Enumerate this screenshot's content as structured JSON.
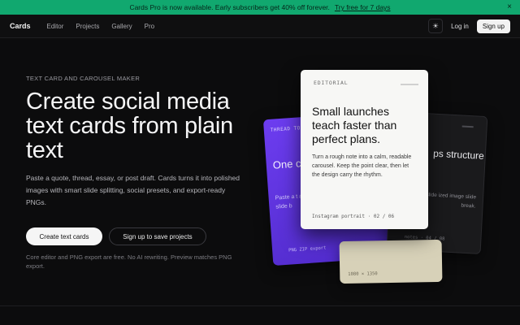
{
  "banner": {
    "message": "Cards Pro is now available. Early subscribers get 40% off forever.",
    "cta": "Try free for 7 days",
    "close": "×"
  },
  "nav": {
    "brand": "Cards",
    "links": [
      "Editor",
      "Projects",
      "Gallery",
      "Pro"
    ],
    "theme_icon": "☀",
    "login": "Log in",
    "signup": "Sign up"
  },
  "hero": {
    "eyebrow": "TEXT CARD AND CAROUSEL MAKER",
    "title": "Create social media text cards from plain text",
    "subtitle": "Paste a quote, thread, essay, or post draft. Cards turns it into polished images with smart slide splitting, social presets, and export-ready PNGs.",
    "primary_cta": "Create text cards",
    "secondary_cta": "Sign up to save projects",
    "note": "Core editor and PNG export are free. No AI rewriting. Preview matches PNG export."
  },
  "cards": {
    "purple": {
      "label": "THREAD TO",
      "headline": "One c clear",
      "body": "Paste a t automat slide b",
      "footer": "PNG ZIP export"
    },
    "dark": {
      "headline": "ps structure",
      "body": "date, or slide ized image slide break.",
      "footer": "notes · 04 / 08"
    },
    "beige": {
      "footer": "1080 × 1350"
    },
    "white": {
      "label": "EDITORIAL",
      "headline": "Small launches teach faster than perfect plans.",
      "body": "Turn a rough note into a calm, readable carousel. Keep the point clear, then let the design carry the rhythm.",
      "footer": "Instagram portrait · 02 / 06"
    }
  },
  "colors": {
    "banner": "#11a86f",
    "background": "#0c0c0d",
    "purple_card": "#6d3df0"
  }
}
